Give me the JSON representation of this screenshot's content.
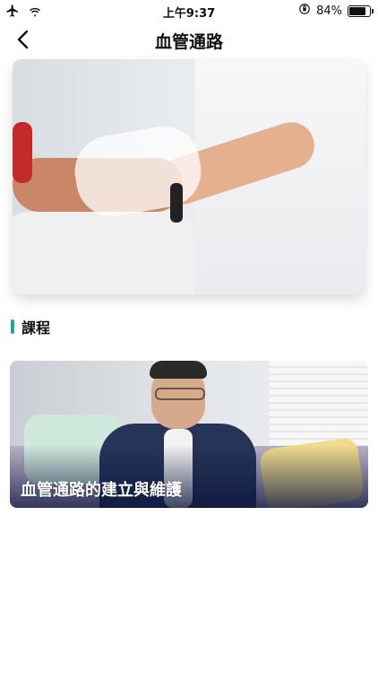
{
  "status_bar": {
    "time": "上午9:37",
    "battery_percent_text": "84%",
    "battery_level": 0.84
  },
  "header": {
    "title": "血管通路"
  },
  "section": {
    "title": "課程"
  },
  "course": {
    "title": "血管通路的建立與維護"
  },
  "colors": {
    "accent": "#19a7a3"
  },
  "icons": {
    "back": "chevron-left-icon",
    "airplane": "airplane-icon",
    "wifi": "wifi-icon",
    "orientation_lock": "orientation-lock-icon",
    "battery": "battery-icon"
  }
}
